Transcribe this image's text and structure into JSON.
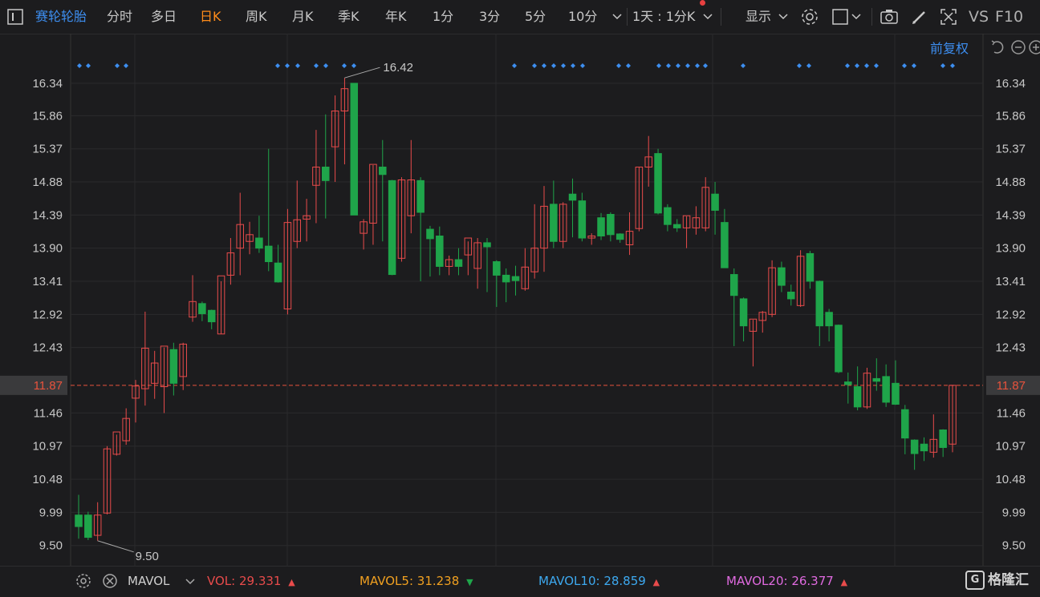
{
  "toolbar": {
    "menu_icon": "menu-icon",
    "stock_name": "赛轮轮胎",
    "periods": [
      "分时",
      "多日",
      "日K",
      "周K",
      "月K",
      "季K",
      "年K",
      "1分",
      "3分",
      "5分",
      "10分"
    ],
    "active_period": "日K",
    "combo_label": "1天 : 1分K",
    "display_label": "显示",
    "vs_label": "VS",
    "f10_label": "F10"
  },
  "sub_toolbar": {
    "adjust_label": "前复权"
  },
  "colors": {
    "up": "#e84b4b",
    "down": "#1fa54a",
    "background": "#1c1c1e",
    "grid": "#2a2a2c",
    "accent": "#3d8ef0",
    "active": "#ff8c1a",
    "price_line": "#e8533d"
  },
  "price_axis": {
    "ticks": [
      "16.34",
      "15.86",
      "15.37",
      "14.88",
      "14.39",
      "13.90",
      "13.41",
      "12.92",
      "12.43",
      "11.87",
      "11.46",
      "10.97",
      "10.48",
      "9.99",
      "9.50"
    ],
    "current_price": "11.87",
    "min": 9.2,
    "max": 16.6
  },
  "annotations": {
    "high": "16.42",
    "low": "9.50"
  },
  "chart_data": {
    "type": "candlestick",
    "ylim": [
      9.2,
      16.6
    ],
    "candles": [
      {
        "o": 9.95,
        "h": 10.25,
        "l": 9.6,
        "c": 9.78
      },
      {
        "o": 9.95,
        "h": 10.0,
        "l": 9.58,
        "c": 9.62
      },
      {
        "o": 9.65,
        "h": 10.14,
        "l": 9.57,
        "c": 9.95
      },
      {
        "o": 9.98,
        "h": 10.97,
        "l": 9.96,
        "c": 10.93
      },
      {
        "o": 10.85,
        "h": 11.14,
        "l": 10.83,
        "c": 11.18
      },
      {
        "o": 11.05,
        "h": 11.53,
        "l": 10.99,
        "c": 11.38
      },
      {
        "o": 11.68,
        "h": 11.95,
        "l": 11.32,
        "c": 11.86
      },
      {
        "o": 11.82,
        "h": 12.96,
        "l": 11.57,
        "c": 12.42
      },
      {
        "o": 11.9,
        "h": 12.38,
        "l": 11.67,
        "c": 12.2
      },
      {
        "o": 11.85,
        "h": 12.43,
        "l": 11.46,
        "c": 12.45
      },
      {
        "o": 12.4,
        "h": 12.5,
        "l": 11.72,
        "c": 11.9
      },
      {
        "o": 12.0,
        "h": 12.5,
        "l": 11.8,
        "c": 12.48
      },
      {
        "o": 12.88,
        "h": 13.5,
        "l": 12.81,
        "c": 13.11
      },
      {
        "o": 13.08,
        "h": 13.11,
        "l": 12.82,
        "c": 12.93
      },
      {
        "o": 12.98,
        "h": 12.99,
        "l": 12.7,
        "c": 12.81
      },
      {
        "o": 12.63,
        "h": 13.41,
        "l": 12.63,
        "c": 13.49
      },
      {
        "o": 13.5,
        "h": 14.05,
        "l": 13.36,
        "c": 13.83
      },
      {
        "o": 13.9,
        "h": 14.72,
        "l": 13.5,
        "c": 14.25
      },
      {
        "o": 14.0,
        "h": 14.29,
        "l": 13.81,
        "c": 14.1
      },
      {
        "o": 14.05,
        "h": 14.38,
        "l": 13.83,
        "c": 13.9
      },
      {
        "o": 13.93,
        "h": 15.37,
        "l": 13.56,
        "c": 13.7
      },
      {
        "o": 13.68,
        "h": 13.95,
        "l": 13.39,
        "c": 13.4
      },
      {
        "o": 13.0,
        "h": 14.48,
        "l": 12.92,
        "c": 14.28
      },
      {
        "o": 14.0,
        "h": 14.9,
        "l": 13.9,
        "c": 14.32
      },
      {
        "o": 14.33,
        "h": 14.63,
        "l": 14.0,
        "c": 14.38
      },
      {
        "o": 14.83,
        "h": 15.65,
        "l": 14.27,
        "c": 15.1
      },
      {
        "o": 15.1,
        "h": 15.88,
        "l": 14.34,
        "c": 14.9
      },
      {
        "o": 15.4,
        "h": 16.16,
        "l": 14.88,
        "c": 15.93
      },
      {
        "o": 15.93,
        "h": 16.42,
        "l": 15.14,
        "c": 16.26
      },
      {
        "o": 16.34,
        "h": 16.34,
        "l": 14.39,
        "c": 14.39
      },
      {
        "o": 14.12,
        "h": 14.33,
        "l": 13.88,
        "c": 14.29
      },
      {
        "o": 14.27,
        "h": 15.13,
        "l": 13.95,
        "c": 15.14
      },
      {
        "o": 15.1,
        "h": 15.5,
        "l": 14.0,
        "c": 14.99
      },
      {
        "o": 14.9,
        "h": 14.91,
        "l": 13.5,
        "c": 13.51
      },
      {
        "o": 13.75,
        "h": 14.95,
        "l": 13.7,
        "c": 14.91
      },
      {
        "o": 14.38,
        "h": 15.5,
        "l": 14.12,
        "c": 14.91
      },
      {
        "o": 14.9,
        "h": 14.95,
        "l": 13.41,
        "c": 14.43
      },
      {
        "o": 14.18,
        "h": 14.23,
        "l": 13.48,
        "c": 14.04
      },
      {
        "o": 14.08,
        "h": 14.22,
        "l": 13.5,
        "c": 13.63
      },
      {
        "o": 13.63,
        "h": 13.79,
        "l": 13.5,
        "c": 13.73
      },
      {
        "o": 13.73,
        "h": 13.9,
        "l": 13.5,
        "c": 13.63
      },
      {
        "o": 13.8,
        "h": 14.0,
        "l": 13.5,
        "c": 14.05
      },
      {
        "o": 13.6,
        "h": 14.05,
        "l": 13.3,
        "c": 13.98
      },
      {
        "o": 13.98,
        "h": 14.05,
        "l": 13.25,
        "c": 13.92
      },
      {
        "o": 13.7,
        "h": 13.72,
        "l": 13.03,
        "c": 13.5
      },
      {
        "o": 13.5,
        "h": 13.6,
        "l": 13.1,
        "c": 13.4
      },
      {
        "o": 13.48,
        "h": 13.64,
        "l": 13.2,
        "c": 13.42
      },
      {
        "o": 13.3,
        "h": 13.9,
        "l": 13.27,
        "c": 13.62
      },
      {
        "o": 13.55,
        "h": 14.55,
        "l": 13.45,
        "c": 13.9
      },
      {
        "o": 13.9,
        "h": 14.82,
        "l": 13.55,
        "c": 14.52
      },
      {
        "o": 14.55,
        "h": 14.9,
        "l": 13.9,
        "c": 14.0
      },
      {
        "o": 14.0,
        "h": 14.58,
        "l": 13.9,
        "c": 14.55
      },
      {
        "o": 14.7,
        "h": 14.93,
        "l": 14.06,
        "c": 14.61
      },
      {
        "o": 14.6,
        "h": 14.72,
        "l": 14.0,
        "c": 14.05
      },
      {
        "o": 14.05,
        "h": 14.12,
        "l": 13.95,
        "c": 14.08
      },
      {
        "o": 14.35,
        "h": 14.42,
        "l": 14.02,
        "c": 14.08
      },
      {
        "o": 14.4,
        "h": 14.43,
        "l": 14.0,
        "c": 14.1
      },
      {
        "o": 14.11,
        "h": 14.12,
        "l": 13.98,
        "c": 14.03
      },
      {
        "o": 13.95,
        "h": 14.43,
        "l": 13.8,
        "c": 14.15
      },
      {
        "o": 14.19,
        "h": 15.1,
        "l": 14.15,
        "c": 15.1
      },
      {
        "o": 15.1,
        "h": 15.56,
        "l": 14.81,
        "c": 15.25
      },
      {
        "o": 15.3,
        "h": 15.37,
        "l": 14.4,
        "c": 14.42
      },
      {
        "o": 14.5,
        "h": 14.55,
        "l": 14.15,
        "c": 14.25
      },
      {
        "o": 14.25,
        "h": 14.33,
        "l": 14.14,
        "c": 14.2
      },
      {
        "o": 14.2,
        "h": 14.37,
        "l": 13.9,
        "c": 14.38
      },
      {
        "o": 14.2,
        "h": 14.52,
        "l": 14.1,
        "c": 14.35
      },
      {
        "o": 14.2,
        "h": 14.95,
        "l": 14.15,
        "c": 14.8
      },
      {
        "o": 14.7,
        "h": 14.88,
        "l": 14.1,
        "c": 14.46
      },
      {
        "o": 14.28,
        "h": 14.48,
        "l": 13.75,
        "c": 13.61
      },
      {
        "o": 13.51,
        "h": 13.6,
        "l": 12.45,
        "c": 13.2
      },
      {
        "o": 13.15,
        "h": 13.17,
        "l": 12.52,
        "c": 12.75
      },
      {
        "o": 12.67,
        "h": 12.84,
        "l": 12.15,
        "c": 12.85
      },
      {
        "o": 12.83,
        "h": 12.97,
        "l": 12.65,
        "c": 12.95
      },
      {
        "o": 12.92,
        "h": 13.72,
        "l": 12.88,
        "c": 13.61
      },
      {
        "o": 13.61,
        "h": 13.7,
        "l": 13.25,
        "c": 13.35
      },
      {
        "o": 13.25,
        "h": 13.36,
        "l": 13.05,
        "c": 13.15
      },
      {
        "o": 13.05,
        "h": 13.87,
        "l": 13.03,
        "c": 13.78
      },
      {
        "o": 13.82,
        "h": 13.86,
        "l": 13.3,
        "c": 13.41
      },
      {
        "o": 13.41,
        "h": 13.42,
        "l": 12.45,
        "c": 12.75
      },
      {
        "o": 12.95,
        "h": 13.0,
        "l": 12.52,
        "c": 12.75
      },
      {
        "o": 12.76,
        "h": 12.77,
        "l": 12.05,
        "c": 12.07
      },
      {
        "o": 11.92,
        "h": 12.06,
        "l": 11.6,
        "c": 11.88
      },
      {
        "o": 11.85,
        "h": 12.15,
        "l": 11.5,
        "c": 11.55
      },
      {
        "o": 11.55,
        "h": 12.13,
        "l": 11.52,
        "c": 12.05
      },
      {
        "o": 11.97,
        "h": 12.27,
        "l": 11.79,
        "c": 11.93
      },
      {
        "o": 12.0,
        "h": 12.18,
        "l": 11.55,
        "c": 11.62
      },
      {
        "o": 11.9,
        "h": 12.24,
        "l": 11.58,
        "c": 11.59
      },
      {
        "o": 11.51,
        "h": 11.58,
        "l": 10.85,
        "c": 11.09
      },
      {
        "o": 11.06,
        "h": 11.07,
        "l": 10.62,
        "c": 10.86
      },
      {
        "o": 11.0,
        "h": 11.1,
        "l": 10.75,
        "c": 10.9
      },
      {
        "o": 10.88,
        "h": 11.44,
        "l": 10.8,
        "c": 11.07
      },
      {
        "o": 11.21,
        "h": 11.22,
        "l": 10.81,
        "c": 10.95
      },
      {
        "o": 11.0,
        "h": 11.87,
        "l": 10.88,
        "c": 11.87
      }
    ]
  },
  "bottom": {
    "settings_icon": "gear-icon",
    "close_icon": "close-icon",
    "indicator": "MAVOL",
    "vol_label": "VOL: ",
    "vol_value": "29.331",
    "mavol5_label": "MAVOL5: ",
    "mavol5_value": "31.238",
    "mavol10_label": "MAVOL10: ",
    "mavol10_value": "28.859",
    "mavol20_label": "MAVOL20: ",
    "mavol20_value": "26.377",
    "logo_text": "格隆汇"
  }
}
